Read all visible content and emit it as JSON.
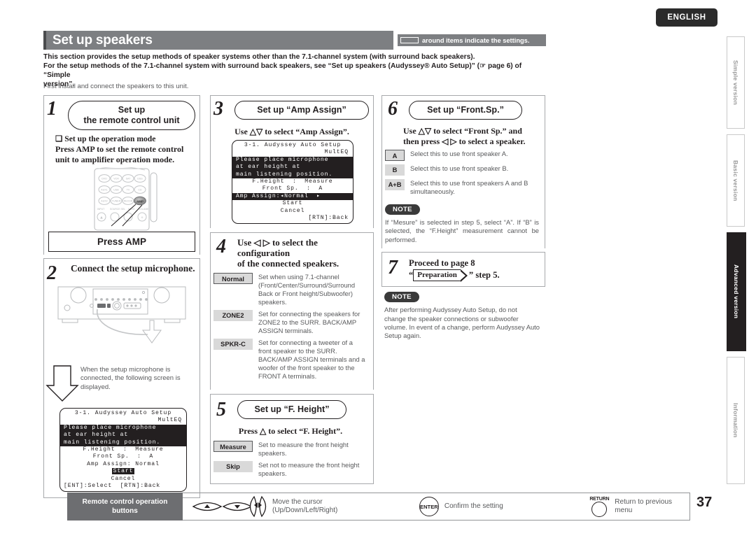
{
  "language_badge": "ENGLISH",
  "side_tabs": [
    {
      "label": "Simple version",
      "active": false
    },
    {
      "label": "Basic version",
      "active": false
    },
    {
      "label": "Advanced version",
      "active": true
    },
    {
      "label": "Information",
      "active": false
    }
  ],
  "header": {
    "title": "Set up speakers",
    "legend_text": "around items indicate the settings."
  },
  "intro": {
    "line1": "This section provides the setup methods of speaker systems other than the 7.1-channel system (with surround back speakers).",
    "line2": "For the setup methods of the 7.1-channel system with surround back speakers, see “Set up speakers (Audyssey® Auto Setup)” (☞ page 6) of “Simple",
    "line3": "version”.",
    "note": "First install and connect the speakers to this unit."
  },
  "step1": {
    "number": "1",
    "title_line1": "Set up",
    "title_line2": "the remote control unit",
    "bullet": "❑ Set up the operation mode",
    "body_line1": "Press AMP to set the remote control",
    "body_line2": "unit to amplifier operation mode.",
    "callout": "Press AMP",
    "remote_buttons": [
      "DVD",
      "VCR",
      "SAT",
      "DSS",
      "AUX1",
      "USB",
      "TV",
      "CD",
      "AUX2",
      "TUNER",
      "RECDR",
      "AMP"
    ],
    "remote_bottom_labels": [
      "INPUT",
      "SOURCE SEL",
      "MUTE",
      "VOLUME"
    ],
    "highlighted_button": "AMP"
  },
  "step2": {
    "number": "2",
    "title": "Connect the setup microphone.",
    "caption": "When the setup microphone is connected, the following screen is displayed.",
    "osd": {
      "title": "3-1. Audyssey Auto Setup",
      "subtitle": "MultEQ",
      "message_lines": [
        "Please place microphone",
        "at ear height at",
        "main listening position."
      ],
      "rows": [
        {
          "label": "F.Height",
          "sep": ":",
          "value": "Measure"
        },
        {
          "label": "Front Sp.",
          "sep": ":",
          "value": "A"
        },
        {
          "label": "Amp Assign",
          "sep": ":",
          "value": "Normal"
        }
      ],
      "start": "Start",
      "cancel": "Cancel",
      "footer": "[ENT]:Select  [RTN]:Back"
    }
  },
  "step3": {
    "number": "3",
    "title": "Set up “Amp Assign”",
    "instruction": "Use △▽ to select “Amp Assign”.",
    "osd": {
      "title": "3-1. Audyssey Auto Setup",
      "subtitle": "MultEQ",
      "message_lines": [
        "Please place microphone",
        "at ear height at",
        "main listening position."
      ],
      "rows": [
        {
          "label": "F.Height",
          "sep": ":",
          "value": "Measure"
        },
        {
          "label": "Front Sp.",
          "sep": ":",
          "value": "A"
        }
      ],
      "selected_row": {
        "label": "Amp Assign:",
        "left_arrow": "◂",
        "value": "Normal",
        "right_arrow": "▸"
      },
      "start": "Start",
      "cancel": "Cancel",
      "footer": "[RTN]:Back"
    }
  },
  "step4": {
    "number": "4",
    "title_line1": "Use ◁ ▷ to select the configuration",
    "title_line2": "of the connected speakers.",
    "options": [
      {
        "key": "Normal",
        "boxed": true,
        "desc": "Set when using 7.1-channel (Front/Center/Surround/Surround Back or Front height/Subwoofer) speakers."
      },
      {
        "key": "ZONE2",
        "boxed": false,
        "desc": "Set for connecting the speakers for ZONE2 to the SURR. BACK/AMP ASSIGN terminals."
      },
      {
        "key": "SPKR-C",
        "boxed": false,
        "desc": "Set for connecting a tweeter of a front speaker to the SURR. BACK/AMP ASSIGN terminals and a woofer of the front speaker to the FRONT A terminals."
      }
    ]
  },
  "step5": {
    "number": "5",
    "title": "Set up “F. Height”",
    "instruction": "Press △ to select “F. Height”.",
    "options": [
      {
        "key": "Measure",
        "boxed": true,
        "desc": "Set to measure the front height speakers."
      },
      {
        "key": "Skip",
        "boxed": false,
        "desc": "Set not to measure the front height speakers."
      }
    ]
  },
  "step6": {
    "number": "6",
    "title": "Set up “Front.Sp.”",
    "instruction_line1": "Use △▽ to select “Front Sp.” and",
    "instruction_line2": "then press ◁ ▷ to select a speaker.",
    "options": [
      {
        "key": "A",
        "boxed": true,
        "desc": "Select this to use front speaker A."
      },
      {
        "key": "B",
        "boxed": false,
        "desc": "Select this to use front speaker B."
      },
      {
        "key": "A+B",
        "boxed": false,
        "desc": "Select this to use front speakers A and B simultaneously."
      }
    ],
    "note_badge": "NOTE",
    "note_body": "If “Mesure” is selected in step 5, select “A”. If “B” is selected, the “F.Height” measurement cannot be performed."
  },
  "step7": {
    "number": "7",
    "line1": "Proceed to page 8",
    "quote_open": "“",
    "button": "Preparation",
    "quote_close": "”",
    "suffix": " step 5.",
    "note_badge": "NOTE",
    "note_body": "After performing Audyssey Auto Setup, do not change the speaker connections or subwoofer volume. In event of a change, perform Audyssey Auto Setup again."
  },
  "bottom": {
    "label_line1": "Remote control operation",
    "label_line2": "buttons",
    "cursor_text_line1": "Move the cursor",
    "cursor_text_line2": "(Up/Down/Left/Right)",
    "enter_label": "ENTER",
    "enter_text": "Confirm the setting",
    "return_label": "RETURN",
    "return_text": "Return to previous menu"
  },
  "page_number": "37",
  "colors": {
    "header_gray": "#7d7f82",
    "accent_dark": "#4b4c4e",
    "option_key_bg": "#d9d9d9",
    "body_text": "#58595b",
    "active_tab": "#231f20"
  }
}
